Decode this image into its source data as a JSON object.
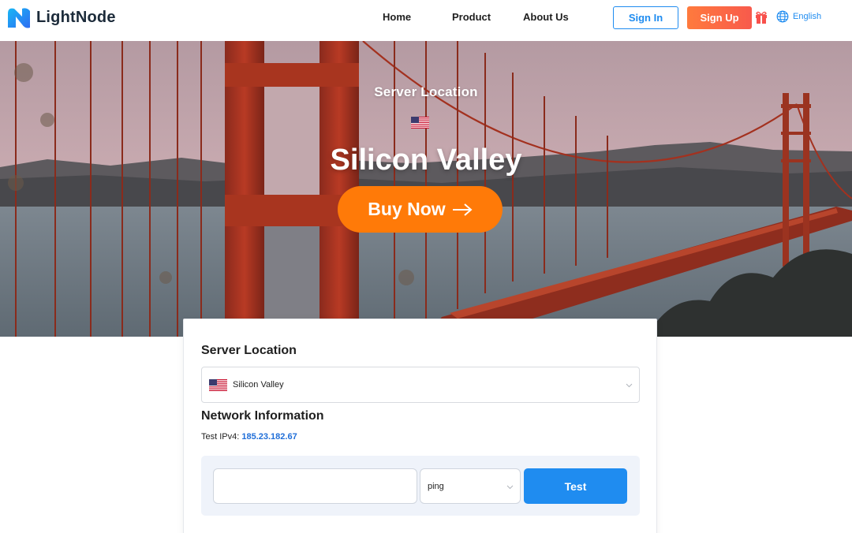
{
  "header": {
    "brand": "LightNode",
    "nav": [
      {
        "label": "Home"
      },
      {
        "label": "Product"
      },
      {
        "label": "About Us"
      }
    ],
    "sign_in": "Sign In",
    "sign_up": "Sign Up",
    "language": "English"
  },
  "hero": {
    "label": "Server Location",
    "city": "Silicon Valley",
    "buy_label": "Buy Now"
  },
  "card": {
    "server_location_heading": "Server Location",
    "selected_location": "Silicon Valley",
    "network_heading": "Network Information",
    "ipv4_label": "Test IPv4:",
    "ipv4_value": "185.23.182.67",
    "test_input_value": "",
    "test_method": "ping",
    "test_button": "Test"
  },
  "colors": {
    "accent_blue": "#1f8cf0",
    "signup_gradient_start": "#ff7a3d",
    "signup_gradient_end": "#f85a4c",
    "buy_orange": "#ff7a08",
    "ip_link": "#1f6ed8"
  },
  "icons": [
    "lightnode-logo-icon",
    "gift-icon",
    "globe-icon",
    "us-flag-icon",
    "arrow-right-icon",
    "chevron-down-icon"
  ]
}
